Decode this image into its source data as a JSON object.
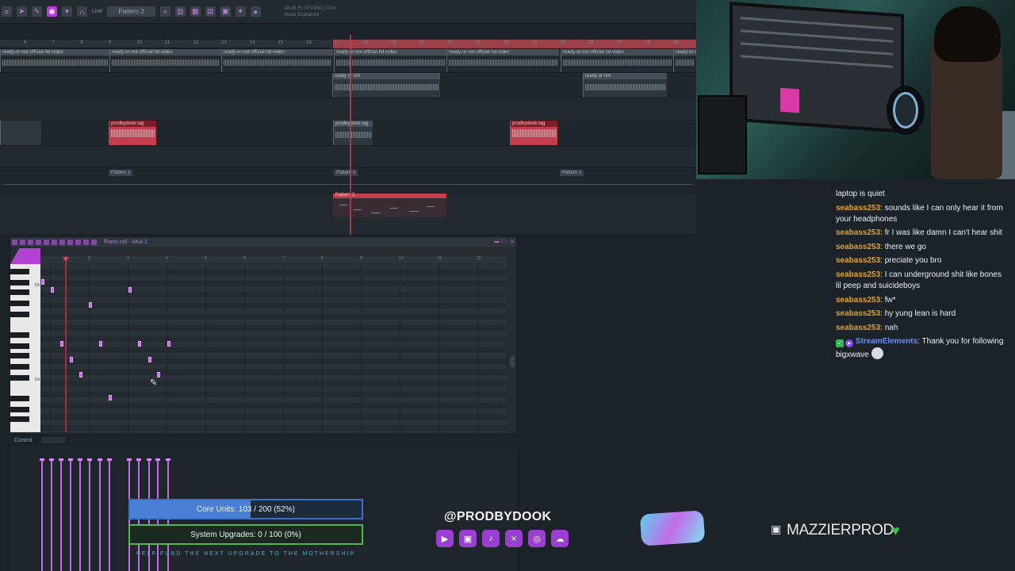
{
  "toolbar": {
    "snap": "Line",
    "pattern": "Pattern 2",
    "hint_top": "18:45  FL STUDIO | CPU",
    "hint_bottom": "Meter Explained"
  },
  "ruler_ticks": [
    "6",
    "7",
    "8",
    "9",
    "10",
    "11",
    "12",
    "13",
    "14",
    "15",
    "16",
    "17",
    "18",
    "19",
    "20",
    "21",
    "22",
    "23",
    "24",
    "25",
    "26",
    "27",
    "28",
    "29"
  ],
  "tracks": {
    "audio_clip_label": "ready-or-not-official-hd-video",
    "vocal_clip_label": "ready or not",
    "tag_clip_label": "prodbydook tag",
    "pattern_label": "Pattern 1",
    "pattern2_label": "Pattern 2"
  },
  "piano_roll": {
    "title": "Piano roll - ANA 2",
    "ruler": [
      "2",
      "3",
      "4",
      "5",
      "6",
      "7",
      "8",
      "9",
      "10",
      "11",
      "12"
    ],
    "key_c5": "C5",
    "key_c4": "C4",
    "control_label": "Control"
  },
  "stats": {
    "core_text": "Core Units: 103 / 200 (52%)",
    "core_progress": 0.52,
    "system_text": "System Upgrades: 0 / 100 (0%)",
    "system_progress": 0.0,
    "fund_text": "HELP FUND THE NEXT UPGRADE TO THE MOTHERSHIP"
  },
  "branding": {
    "handle": "@PRODBYDOOK",
    "twitch_name": "MAZZIERPROD",
    "social_icons": [
      "youtube-icon",
      "twitch-icon",
      "tiktok-icon",
      "x-icon",
      "instagram-icon",
      "soundcloud-icon"
    ],
    "accent": "#9b3fd2",
    "heart_color": "#3fbf4a"
  },
  "chat": {
    "first_line": "laptop is quiet",
    "messages": [
      {
        "user": "seabass253",
        "text": "sounds like I can only hear it from your headphones"
      },
      {
        "user": "seabass253",
        "text": "fr I was like damn I can't hear shit"
      },
      {
        "user": "seabass253",
        "text": "there we go"
      },
      {
        "user": "seabass253",
        "text": "preciate you bro"
      },
      {
        "user": "seabass253",
        "text": "I can underground shit like bones lil peep and suicideboys"
      },
      {
        "user": "seabass253",
        "text": "fw*"
      },
      {
        "user": "seabass253",
        "text": "hy yung lean is hard"
      },
      {
        "user": "seabass253",
        "text": "nah"
      }
    ],
    "system_message": {
      "user": "StreamElements",
      "text": "Thank you for following bigxwave"
    },
    "username_color": "#e0a31e",
    "bot_color": "#6c8cf2"
  }
}
